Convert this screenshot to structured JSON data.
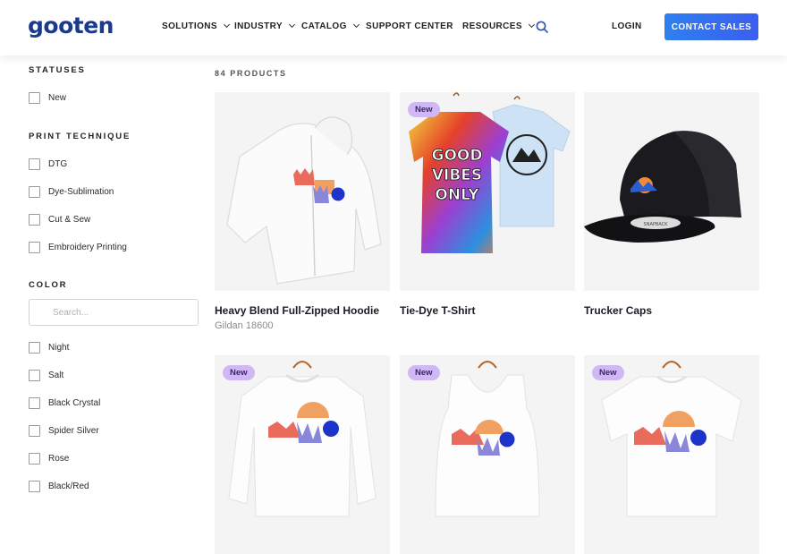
{
  "header": {
    "logo": "gooten",
    "nav": [
      "SOLUTIONS",
      "INDUSTRY",
      "CATALOG",
      "SUPPORT CENTER",
      "RESOURCES"
    ],
    "login": "LOGIN",
    "cta": "CONTACT SALES"
  },
  "sidebar": {
    "statuses": {
      "title": "STATUSES",
      "items": [
        "New"
      ]
    },
    "technique": {
      "title": "PRINT TECHNIQUE",
      "items": [
        "DTG",
        "Dye-Sublimation",
        "Cut & Sew",
        "Embroidery Printing"
      ]
    },
    "color": {
      "title": "COLOR",
      "search_placeholder": "Search...",
      "items": [
        "Night",
        "Salt",
        "Black Crystal",
        "Spider Silver",
        "Rose",
        "Black/Red"
      ]
    }
  },
  "products": {
    "count": "84 PRODUCTS",
    "badge_label": "New",
    "items": [
      {
        "name": "Heavy Blend Full-Zipped Hoodie",
        "sub": "Gildan 18600",
        "new": false
      },
      {
        "name": "Tie-Dye T-Shirt",
        "sub": "",
        "new": true
      },
      {
        "name": "Trucker Caps",
        "sub": "",
        "new": false
      },
      {
        "name": "",
        "sub": "",
        "new": true
      },
      {
        "name": "",
        "sub": "",
        "new": true
      },
      {
        "name": "",
        "sub": "",
        "new": true
      }
    ],
    "tiedye_text": [
      "GOOD",
      "VIBES",
      "ONLY"
    ],
    "cap_label": "SNAPBACK"
  },
  "colors": {
    "brand": "#1d3a8a",
    "cta": "#3b6cf0",
    "badge": "#cfb8f4"
  }
}
